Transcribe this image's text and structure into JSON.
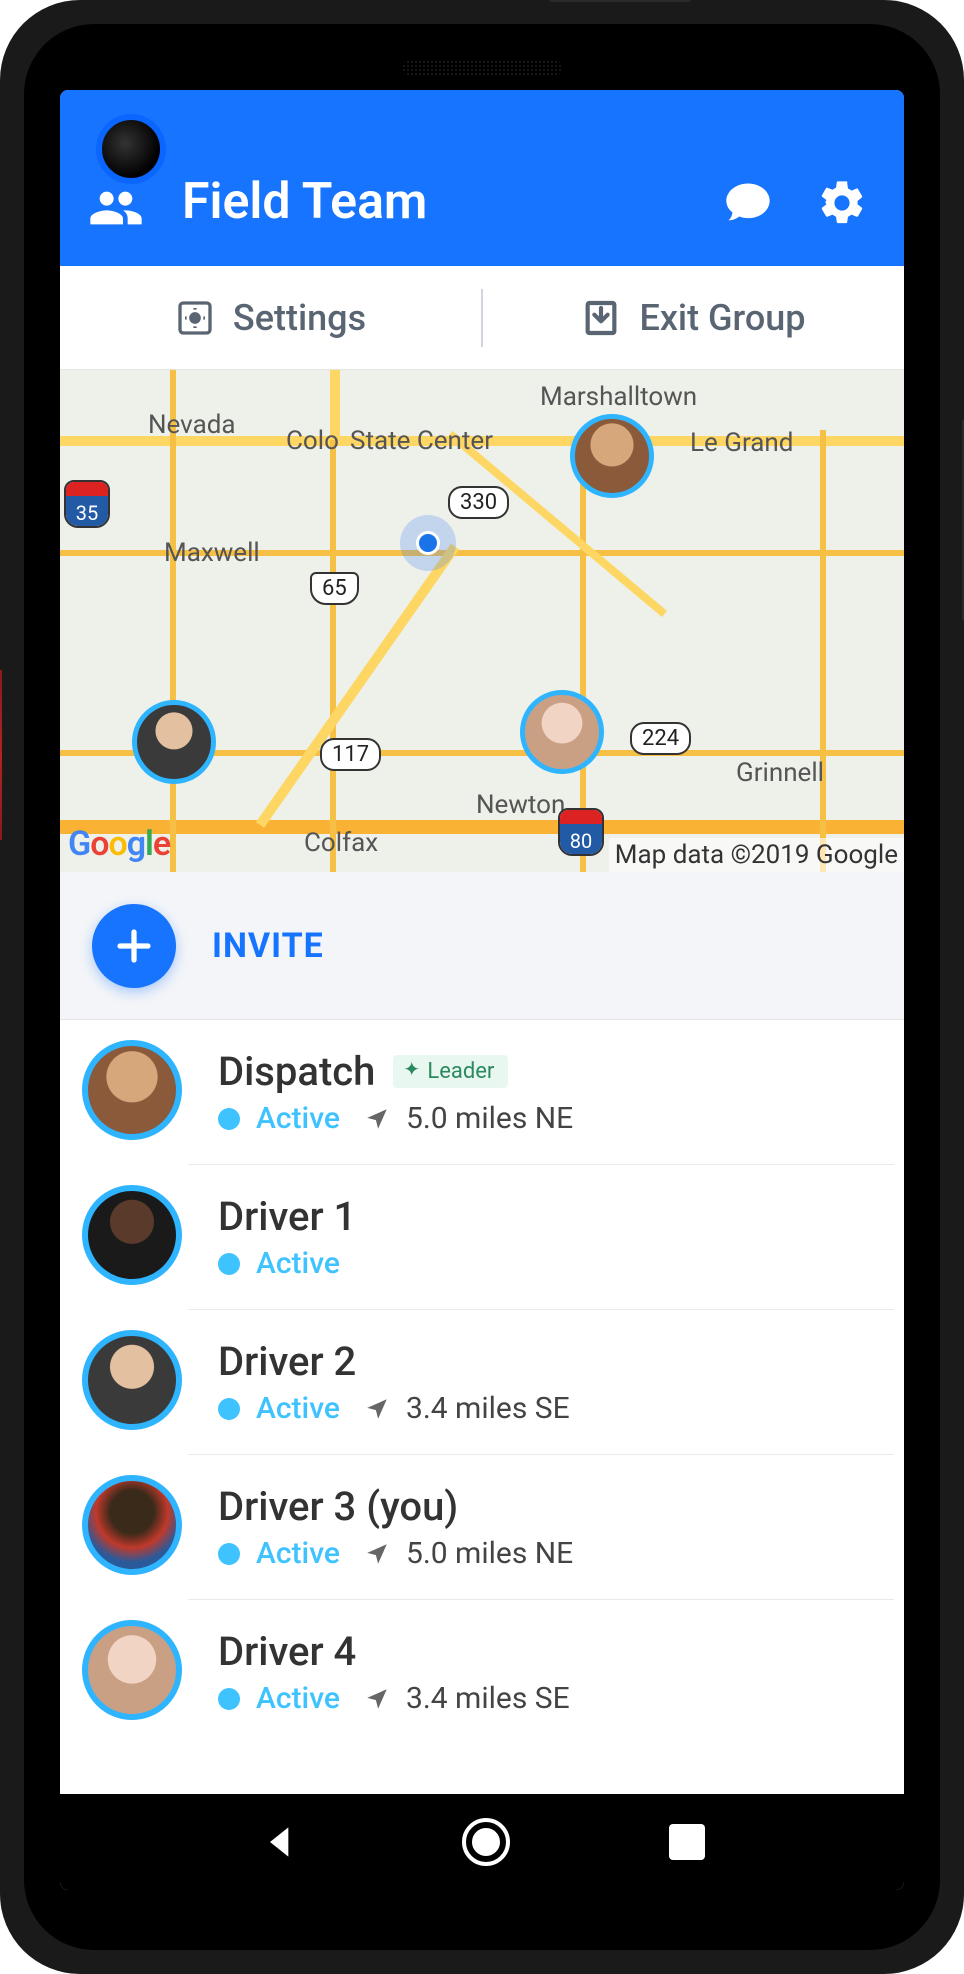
{
  "header": {
    "title": "Field Team"
  },
  "subbar": {
    "settings_label": "Settings",
    "exit_label": "Exit Group"
  },
  "map": {
    "labels": {
      "nevada": "Nevada",
      "colo": "Colo",
      "state_center": "State Center",
      "marshalltown": "Marshalltown",
      "le_grand": "Le Grand",
      "maxwell": "Maxwell",
      "colfax": "Colfax",
      "newton": "Newton",
      "grinnell": "Grinnell"
    },
    "routes": {
      "i35": "35",
      "us65": "65",
      "r330": "330",
      "r117": "117",
      "r224": "224",
      "i80": "80"
    },
    "attribution": "Map data ©2019 Google"
  },
  "invite": {
    "label": "INVITE"
  },
  "members": [
    {
      "name": "Dispatch",
      "badge": "Leader",
      "status": "Active",
      "distance": "5.0 miles NE"
    },
    {
      "name": "Driver 1",
      "badge": null,
      "status": "Active",
      "distance": null
    },
    {
      "name": "Driver 2",
      "badge": null,
      "status": "Active",
      "distance": "3.4 miles SE"
    },
    {
      "name": "Driver 3 (you)",
      "badge": null,
      "status": "Active",
      "distance": "5.0 miles NE"
    },
    {
      "name": "Driver 4",
      "badge": null,
      "status": "Active",
      "distance": "3.4 miles SE"
    }
  ]
}
